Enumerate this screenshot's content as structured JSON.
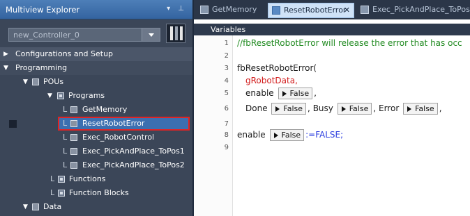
{
  "explorer": {
    "title": "Multiview Explorer",
    "pin_glyphs": "▾ ⊥",
    "controller": "new_Controller_0"
  },
  "tree": {
    "configurations": "Configurations and Setup",
    "programming": "Programming",
    "pous": "POUs",
    "programs": "Programs",
    "items": [
      "GetMemory",
      "ResetRobotError",
      "Exec_RobotControl",
      "Exec_PickAndPlace_ToPos1",
      "Exec_PickAndPlace_ToPos2"
    ],
    "functions": "Functions",
    "function_blocks": "Function Blocks",
    "data": "Data"
  },
  "tabs": [
    {
      "label": "GetMemory"
    },
    {
      "label": "ResetRobotError",
      "close": "✕"
    },
    {
      "label": "Exec_PickAndPlace_ToPos"
    }
  ],
  "variables_label": "Variables",
  "code": {
    "line_numbers": [
      "1",
      "2",
      "3",
      "4",
      "5",
      "6",
      "7",
      "8",
      "9"
    ],
    "comment": "//fbResetRobotError will release the error that has occ",
    "call": "fbResetRobotError(",
    "arg1": "gRobotData,",
    "enable": "enable",
    "false_label": "False",
    "comma": ",",
    "done": "Done",
    "busy": "Busy",
    "error": "Error",
    "assign": ":=FALSE;"
  },
  "colors": {
    "accent": "#3c6fb0",
    "highlight_border": "#e02424",
    "comment": "#228b22",
    "keyword_red": "#d21c1c",
    "literal_blue": "#2a3cdf"
  }
}
